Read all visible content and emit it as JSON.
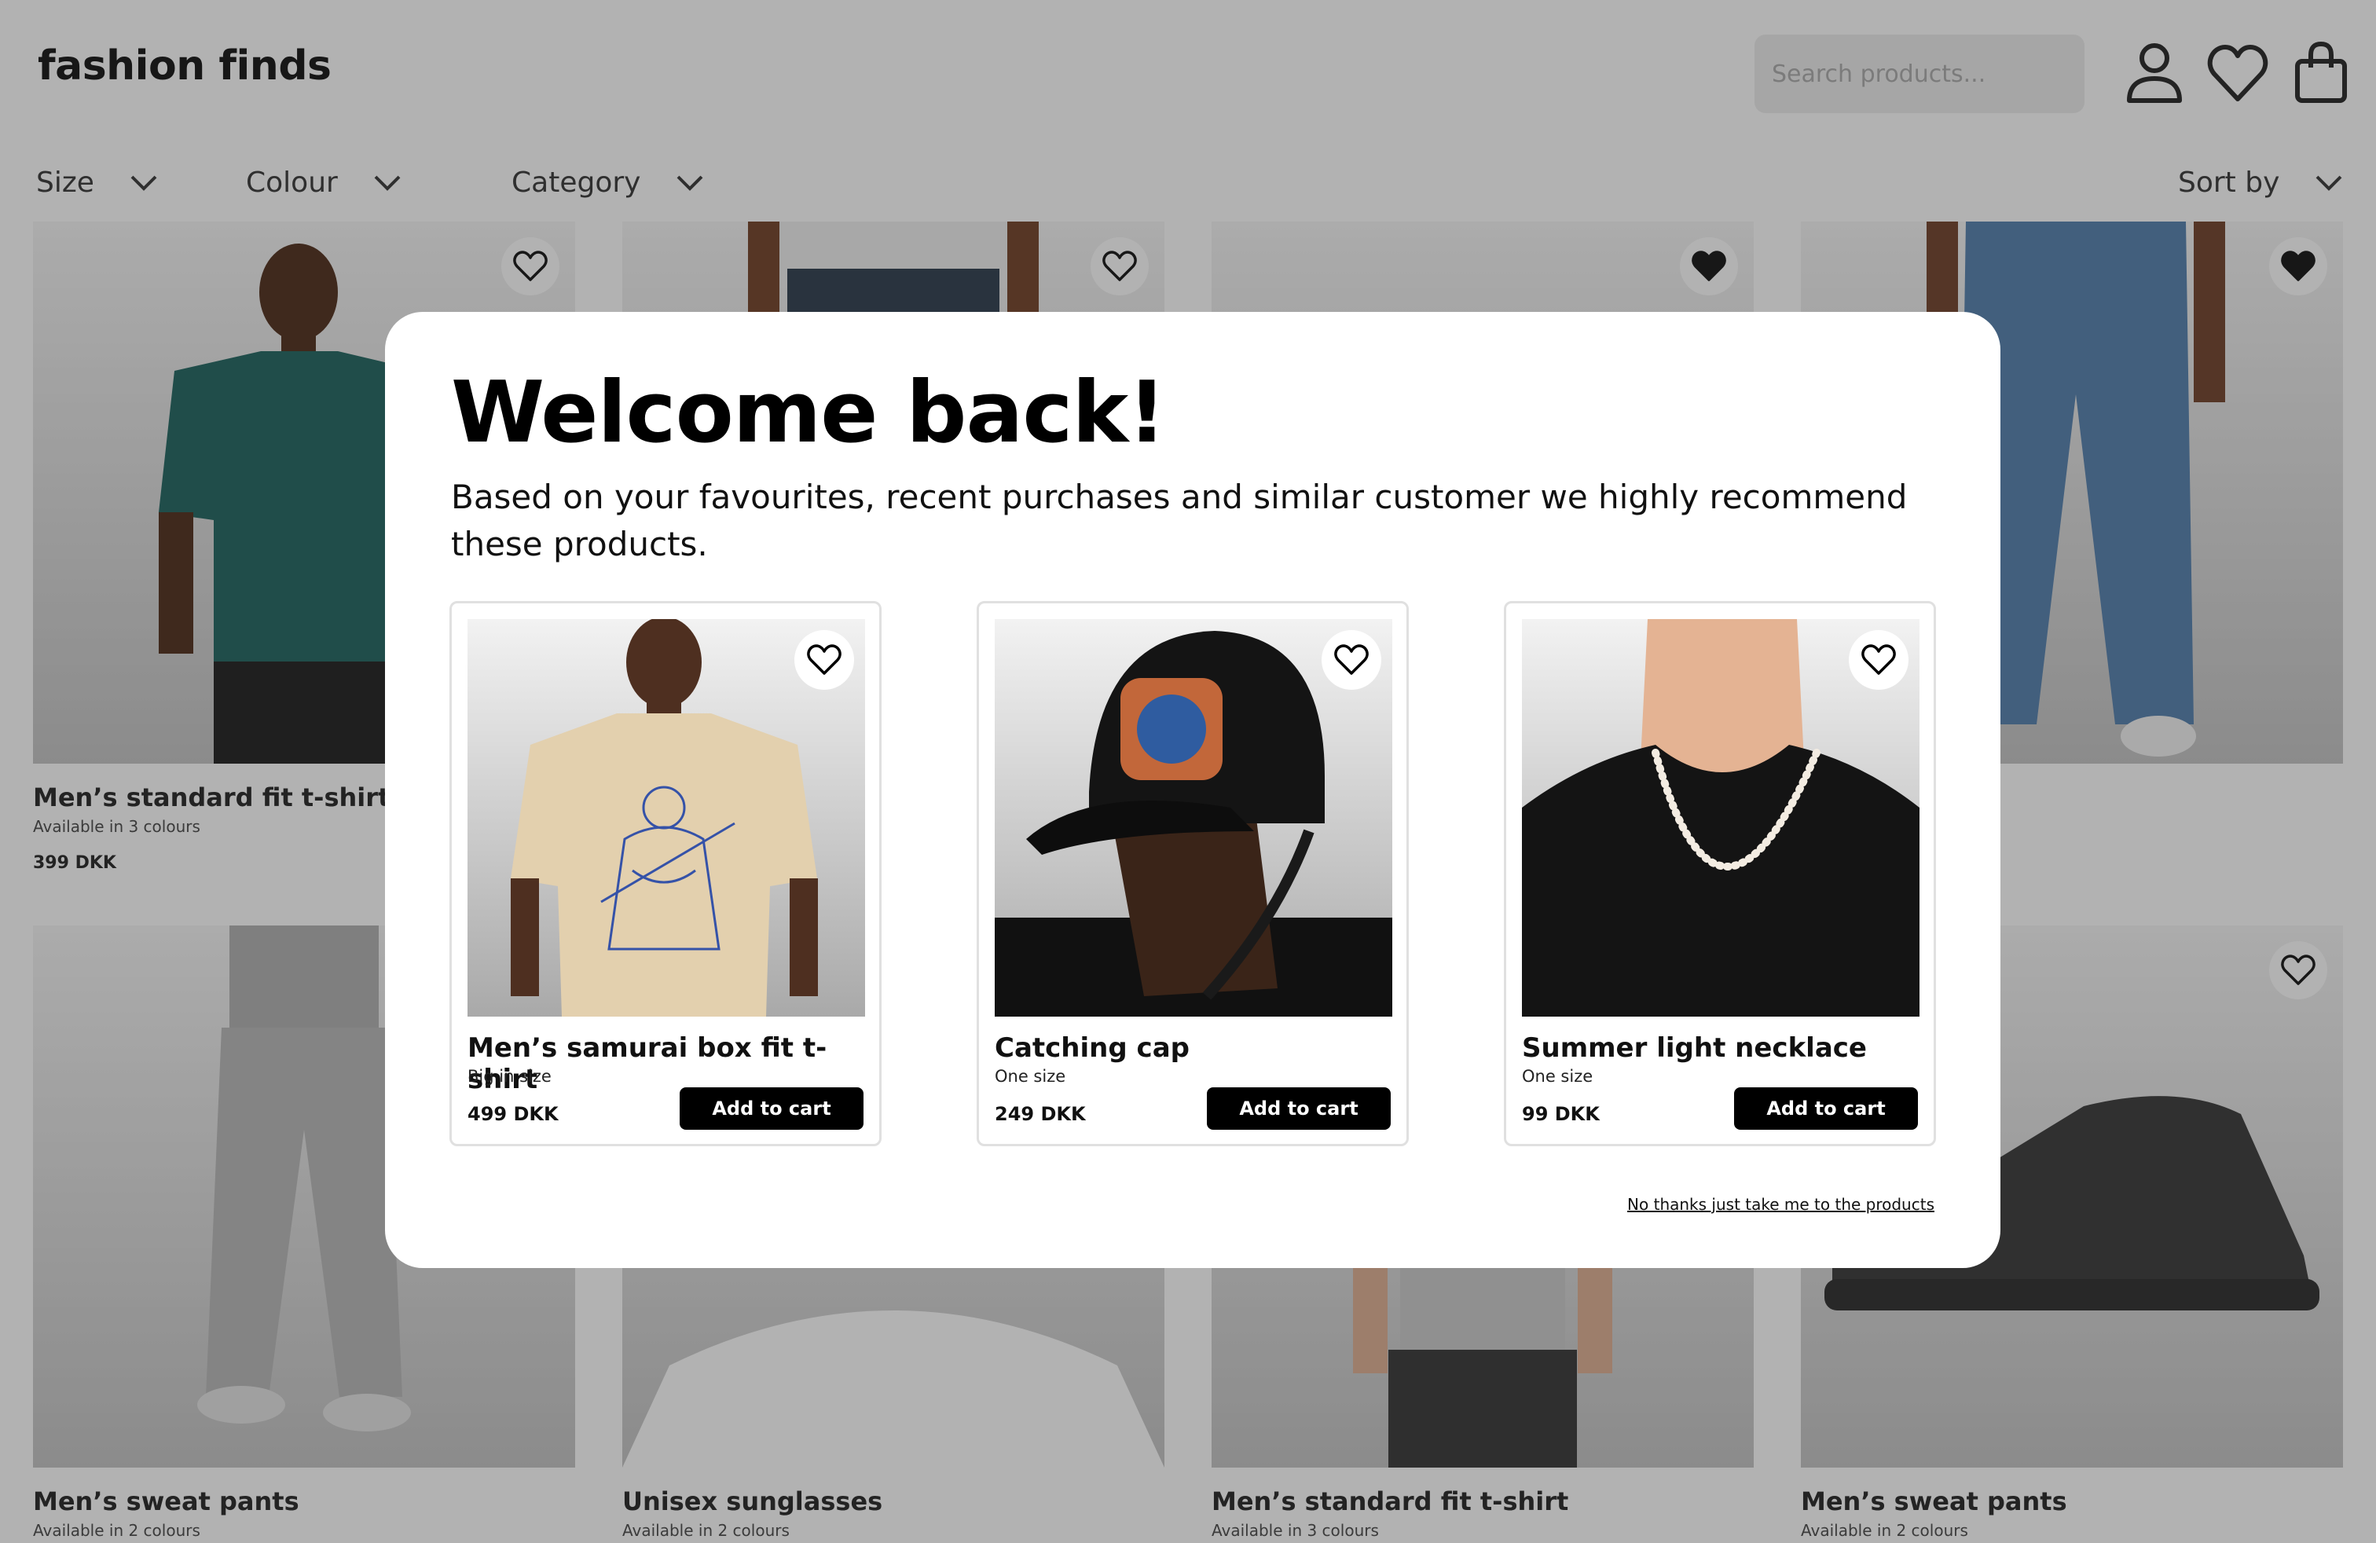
{
  "header": {
    "logo": "fashion finds",
    "search_placeholder": "Search products...",
    "icons": [
      "user-icon",
      "heart-icon",
      "bag-icon"
    ]
  },
  "filters": {
    "size": "Size",
    "colour": "Colour",
    "category": "Category",
    "sort": "Sort by"
  },
  "products": [
    {
      "name": "Men’s standard fit t-shirt",
      "sub": "Available in 3 colours",
      "price": "399 DKK",
      "favourited": false
    },
    {
      "name": "",
      "sub": "",
      "price": "",
      "favourited": false
    },
    {
      "name": "",
      "sub": "",
      "price": "",
      "favourited": true
    },
    {
      "name": "",
      "sub": "",
      "price": "",
      "favourited": true
    },
    {
      "name": "Men’s sweat pants",
      "sub": "Available in 2 colours",
      "price": "",
      "favourited": false
    },
    {
      "name": "Unisex sunglasses",
      "sub": "Available in 2 colours",
      "price": "",
      "favourited": false
    },
    {
      "name": "Men’s standard fit t-shirt",
      "sub": "Available in 3 colours",
      "price": "",
      "favourited": false
    },
    {
      "name": "Men’s sweat pants",
      "sub": "Available in 2 colours",
      "price": "",
      "favourited": false
    }
  ],
  "modal": {
    "title": "Welcome back!",
    "body": "Based on your favourites, recent purchases and similar customer we highly recommend these products.",
    "items": [
      {
        "name": "Men’s samurai box fit t-shirt",
        "sub": "Big in size",
        "price": "499 DKK",
        "button": "Add to cart"
      },
      {
        "name": "Catching cap",
        "sub": "One size",
        "price": "249 DKK",
        "button": "Add to cart"
      },
      {
        "name": "Summer light necklace",
        "sub": "One size",
        "price": "99 DKK",
        "button": "Add to cart"
      }
    ],
    "skip_link": "No thanks just take me to the products"
  },
  "colors": {
    "overlay": "rgba(0,0,0,0.30)",
    "button": "#000000",
    "modal_bg": "#ffffff"
  }
}
